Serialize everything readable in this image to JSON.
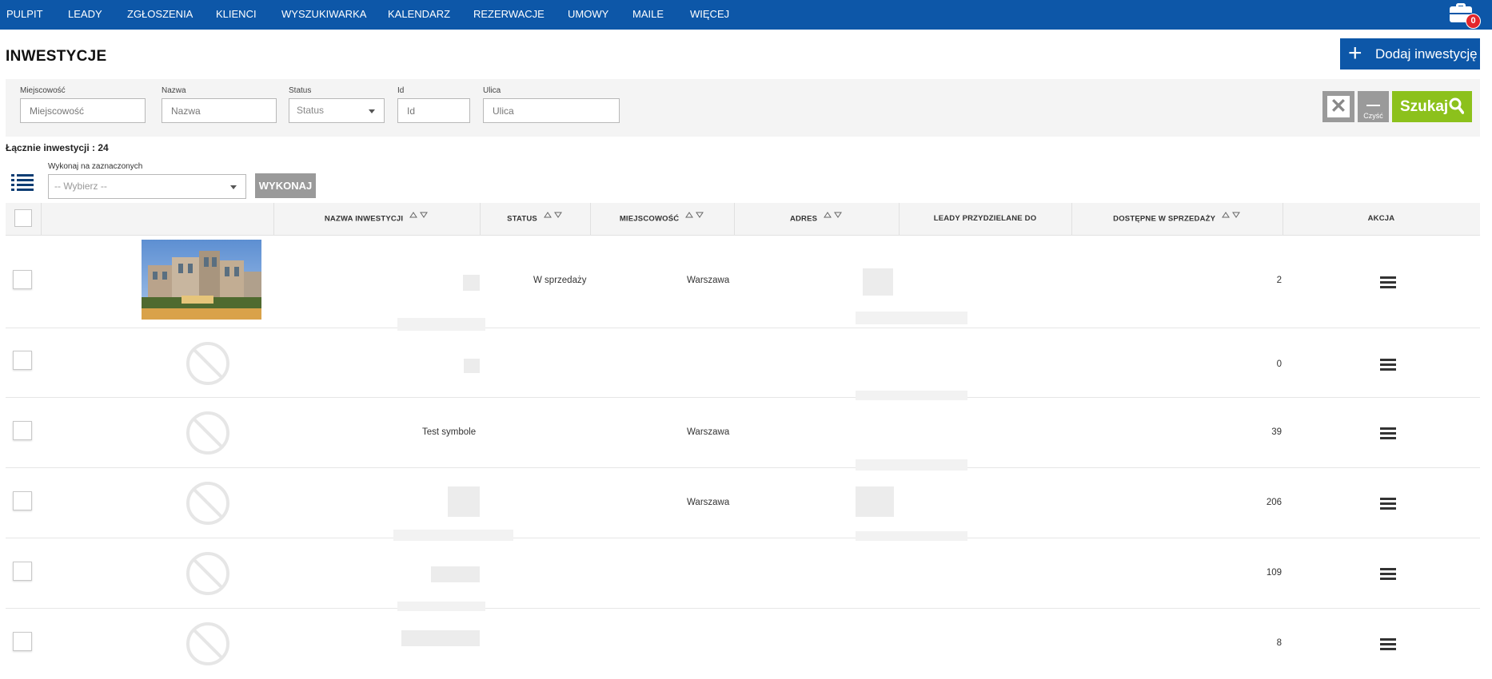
{
  "nav": {
    "items": [
      "PULPIT",
      "LEADY",
      "ZGŁOSZENIA",
      "KLIENCI",
      "WYSZUKIWARKA",
      "KALENDARZ",
      "REZERWACJE",
      "UMOWY",
      "MAILE",
      "WIĘCEJ"
    ],
    "notification_count": "0"
  },
  "page": {
    "title": "INWESTYCJE",
    "add_button": "Dodaj inwestycję"
  },
  "filters": {
    "city_label": "Miejscowość",
    "city_placeholder": "Miejscowość",
    "name_label": "Nazwa",
    "name_placeholder": "Nazwa",
    "status_label": "Status",
    "status_value": "Status",
    "id_label": "Id",
    "id_placeholder": "Id",
    "street_label": "Ulica",
    "street_placeholder": "Ulica",
    "clear_label": "Czyść",
    "search_label": "Szukaj"
  },
  "summary": {
    "total": "Łącznie inwestycji : 24"
  },
  "bulk": {
    "label": "Wykonaj na zaznaczonych",
    "placeholder": "-- Wybierz --",
    "execute": "WYKONAJ"
  },
  "table": {
    "headers": {
      "name": "NAZWA INWESTYCJI",
      "status": "STATUS",
      "city": "MIEJSCOWOŚĆ",
      "address": "ADRES",
      "leads": "LEADY PRZYDZIELANE DO",
      "available": "DOSTĘPNE W SPRZEDAŻY",
      "action": "AKCJA"
    },
    "rows": [
      {
        "name": "",
        "status": "W sprzedaży",
        "city": "Warszawa",
        "available": "2",
        "has_image": true
      },
      {
        "name": "",
        "status": "",
        "city": "",
        "available": "0",
        "has_image": false
      },
      {
        "name": "Test symbole",
        "status": "",
        "city": "Warszawa",
        "available": "39",
        "has_image": false
      },
      {
        "name": "",
        "status": "",
        "city": "Warszawa",
        "available": "206",
        "has_image": false
      },
      {
        "name": "",
        "status": "",
        "city": "",
        "available": "109",
        "has_image": false
      },
      {
        "name": "",
        "status": "",
        "city": "",
        "available": "8",
        "has_image": false
      }
    ]
  },
  "colors": {
    "brand_blue": "#0d57a8",
    "search_green": "#8cc11c",
    "gray_button": "#9a9a9a",
    "badge_red": "#e3262b"
  }
}
